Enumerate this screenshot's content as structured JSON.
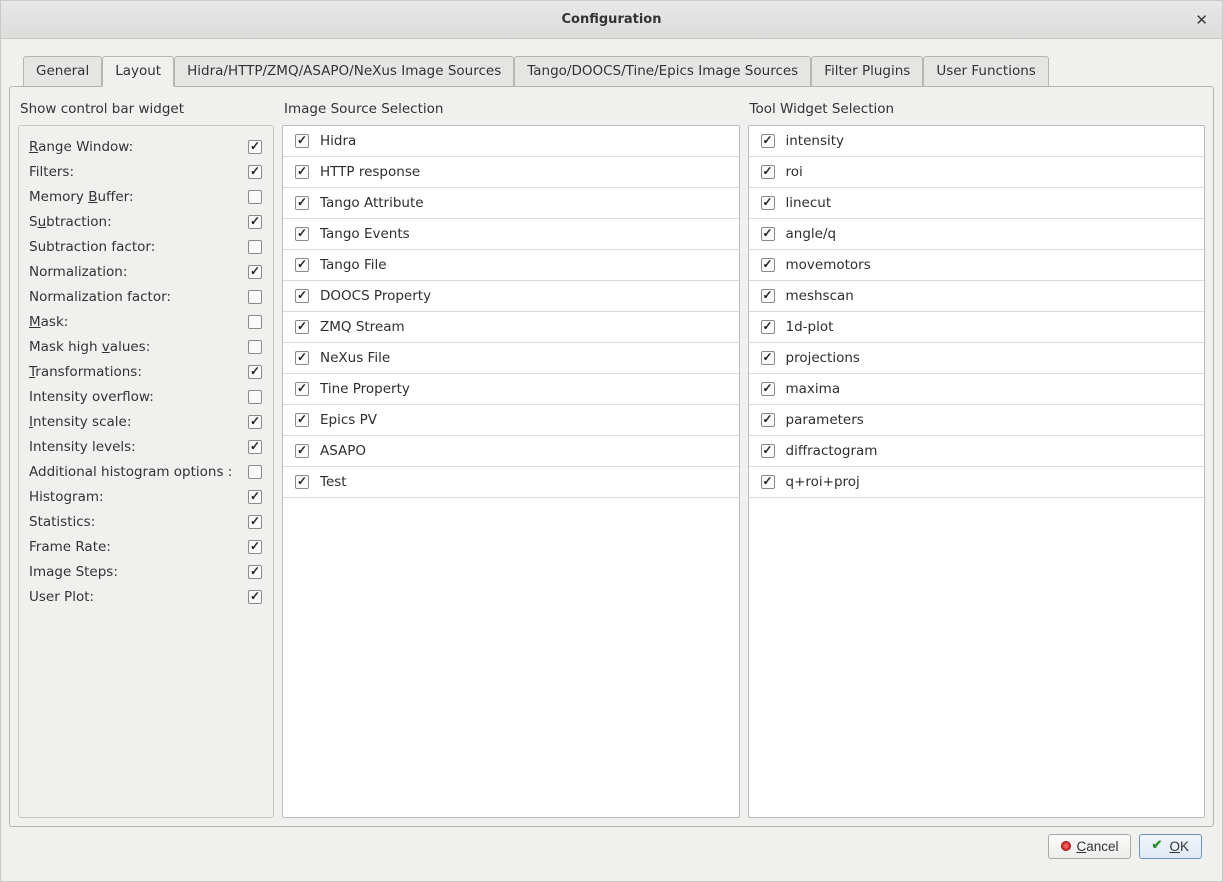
{
  "window": {
    "title": "Configuration"
  },
  "tabs": [
    {
      "label": "General"
    },
    {
      "label": "Layout"
    },
    {
      "label": "Hidra/HTTP/ZMQ/ASAPO/NeXus Image Sources"
    },
    {
      "label": "Tango/DOOCS/Tine/Epics Image Sources"
    },
    {
      "label": "Filter Plugins"
    },
    {
      "label": "User Functions"
    }
  ],
  "active_tab_index": 1,
  "columns": {
    "controlbar": {
      "title": "Show control bar widget",
      "items": [
        {
          "label": "Range Window:",
          "checked": true,
          "mnemonic_index": 0
        },
        {
          "label": "Filters:",
          "checked": true
        },
        {
          "label": "Memory Buffer:",
          "checked": false,
          "mnemonic_index": 7
        },
        {
          "label": "Subtraction:",
          "checked": true,
          "mnemonic_index": 1
        },
        {
          "label": "Subtraction factor:",
          "checked": false
        },
        {
          "label": "Normalization:",
          "checked": true
        },
        {
          "label": "Normalization factor:",
          "checked": false
        },
        {
          "label": "Mask:",
          "checked": false,
          "mnemonic_index": 0
        },
        {
          "label": "Mask high values:",
          "checked": false,
          "mnemonic_index": 10
        },
        {
          "label": "Transformations:",
          "checked": true,
          "mnemonic_index": 0
        },
        {
          "label": "Intensity overflow:",
          "checked": false
        },
        {
          "label": "Intensity scale:",
          "checked": true,
          "mnemonic_index": 0
        },
        {
          "label": "Intensity levels:",
          "checked": true
        },
        {
          "label": "Additional histogram options :",
          "checked": false
        },
        {
          "label": "Histogram:",
          "checked": true
        },
        {
          "label": "Statistics:",
          "checked": true
        },
        {
          "label": "Frame Rate:",
          "checked": true
        },
        {
          "label": "Image Steps:",
          "checked": true
        },
        {
          "label": "User Plot:",
          "checked": true
        }
      ]
    },
    "imagesource": {
      "title": "Image Source Selection",
      "items": [
        {
          "label": "Hidra",
          "checked": true
        },
        {
          "label": "HTTP response",
          "checked": true
        },
        {
          "label": "Tango Attribute",
          "checked": true
        },
        {
          "label": "Tango Events",
          "checked": true
        },
        {
          "label": "Tango File",
          "checked": true
        },
        {
          "label": "DOOCS Property",
          "checked": true
        },
        {
          "label": "ZMQ Stream",
          "checked": true
        },
        {
          "label": "NeXus File",
          "checked": true
        },
        {
          "label": "Tine Property",
          "checked": true
        },
        {
          "label": "Epics PV",
          "checked": true
        },
        {
          "label": "ASAPO",
          "checked": true
        },
        {
          "label": "Test",
          "checked": true
        }
      ]
    },
    "toolwidget": {
      "title": "Tool Widget Selection",
      "items": [
        {
          "label": "intensity",
          "checked": true
        },
        {
          "label": "roi",
          "checked": true
        },
        {
          "label": "linecut",
          "checked": true
        },
        {
          "label": "angle/q",
          "checked": true
        },
        {
          "label": "movemotors",
          "checked": true
        },
        {
          "label": "meshscan",
          "checked": true
        },
        {
          "label": "1d-plot",
          "checked": true
        },
        {
          "label": "projections",
          "checked": true
        },
        {
          "label": "maxima",
          "checked": true
        },
        {
          "label": "parameters",
          "checked": true
        },
        {
          "label": "diffractogram",
          "checked": true
        },
        {
          "label": "q+roi+proj",
          "checked": true
        }
      ]
    }
  },
  "buttons": {
    "cancel": "Cancel",
    "ok": "OK"
  }
}
